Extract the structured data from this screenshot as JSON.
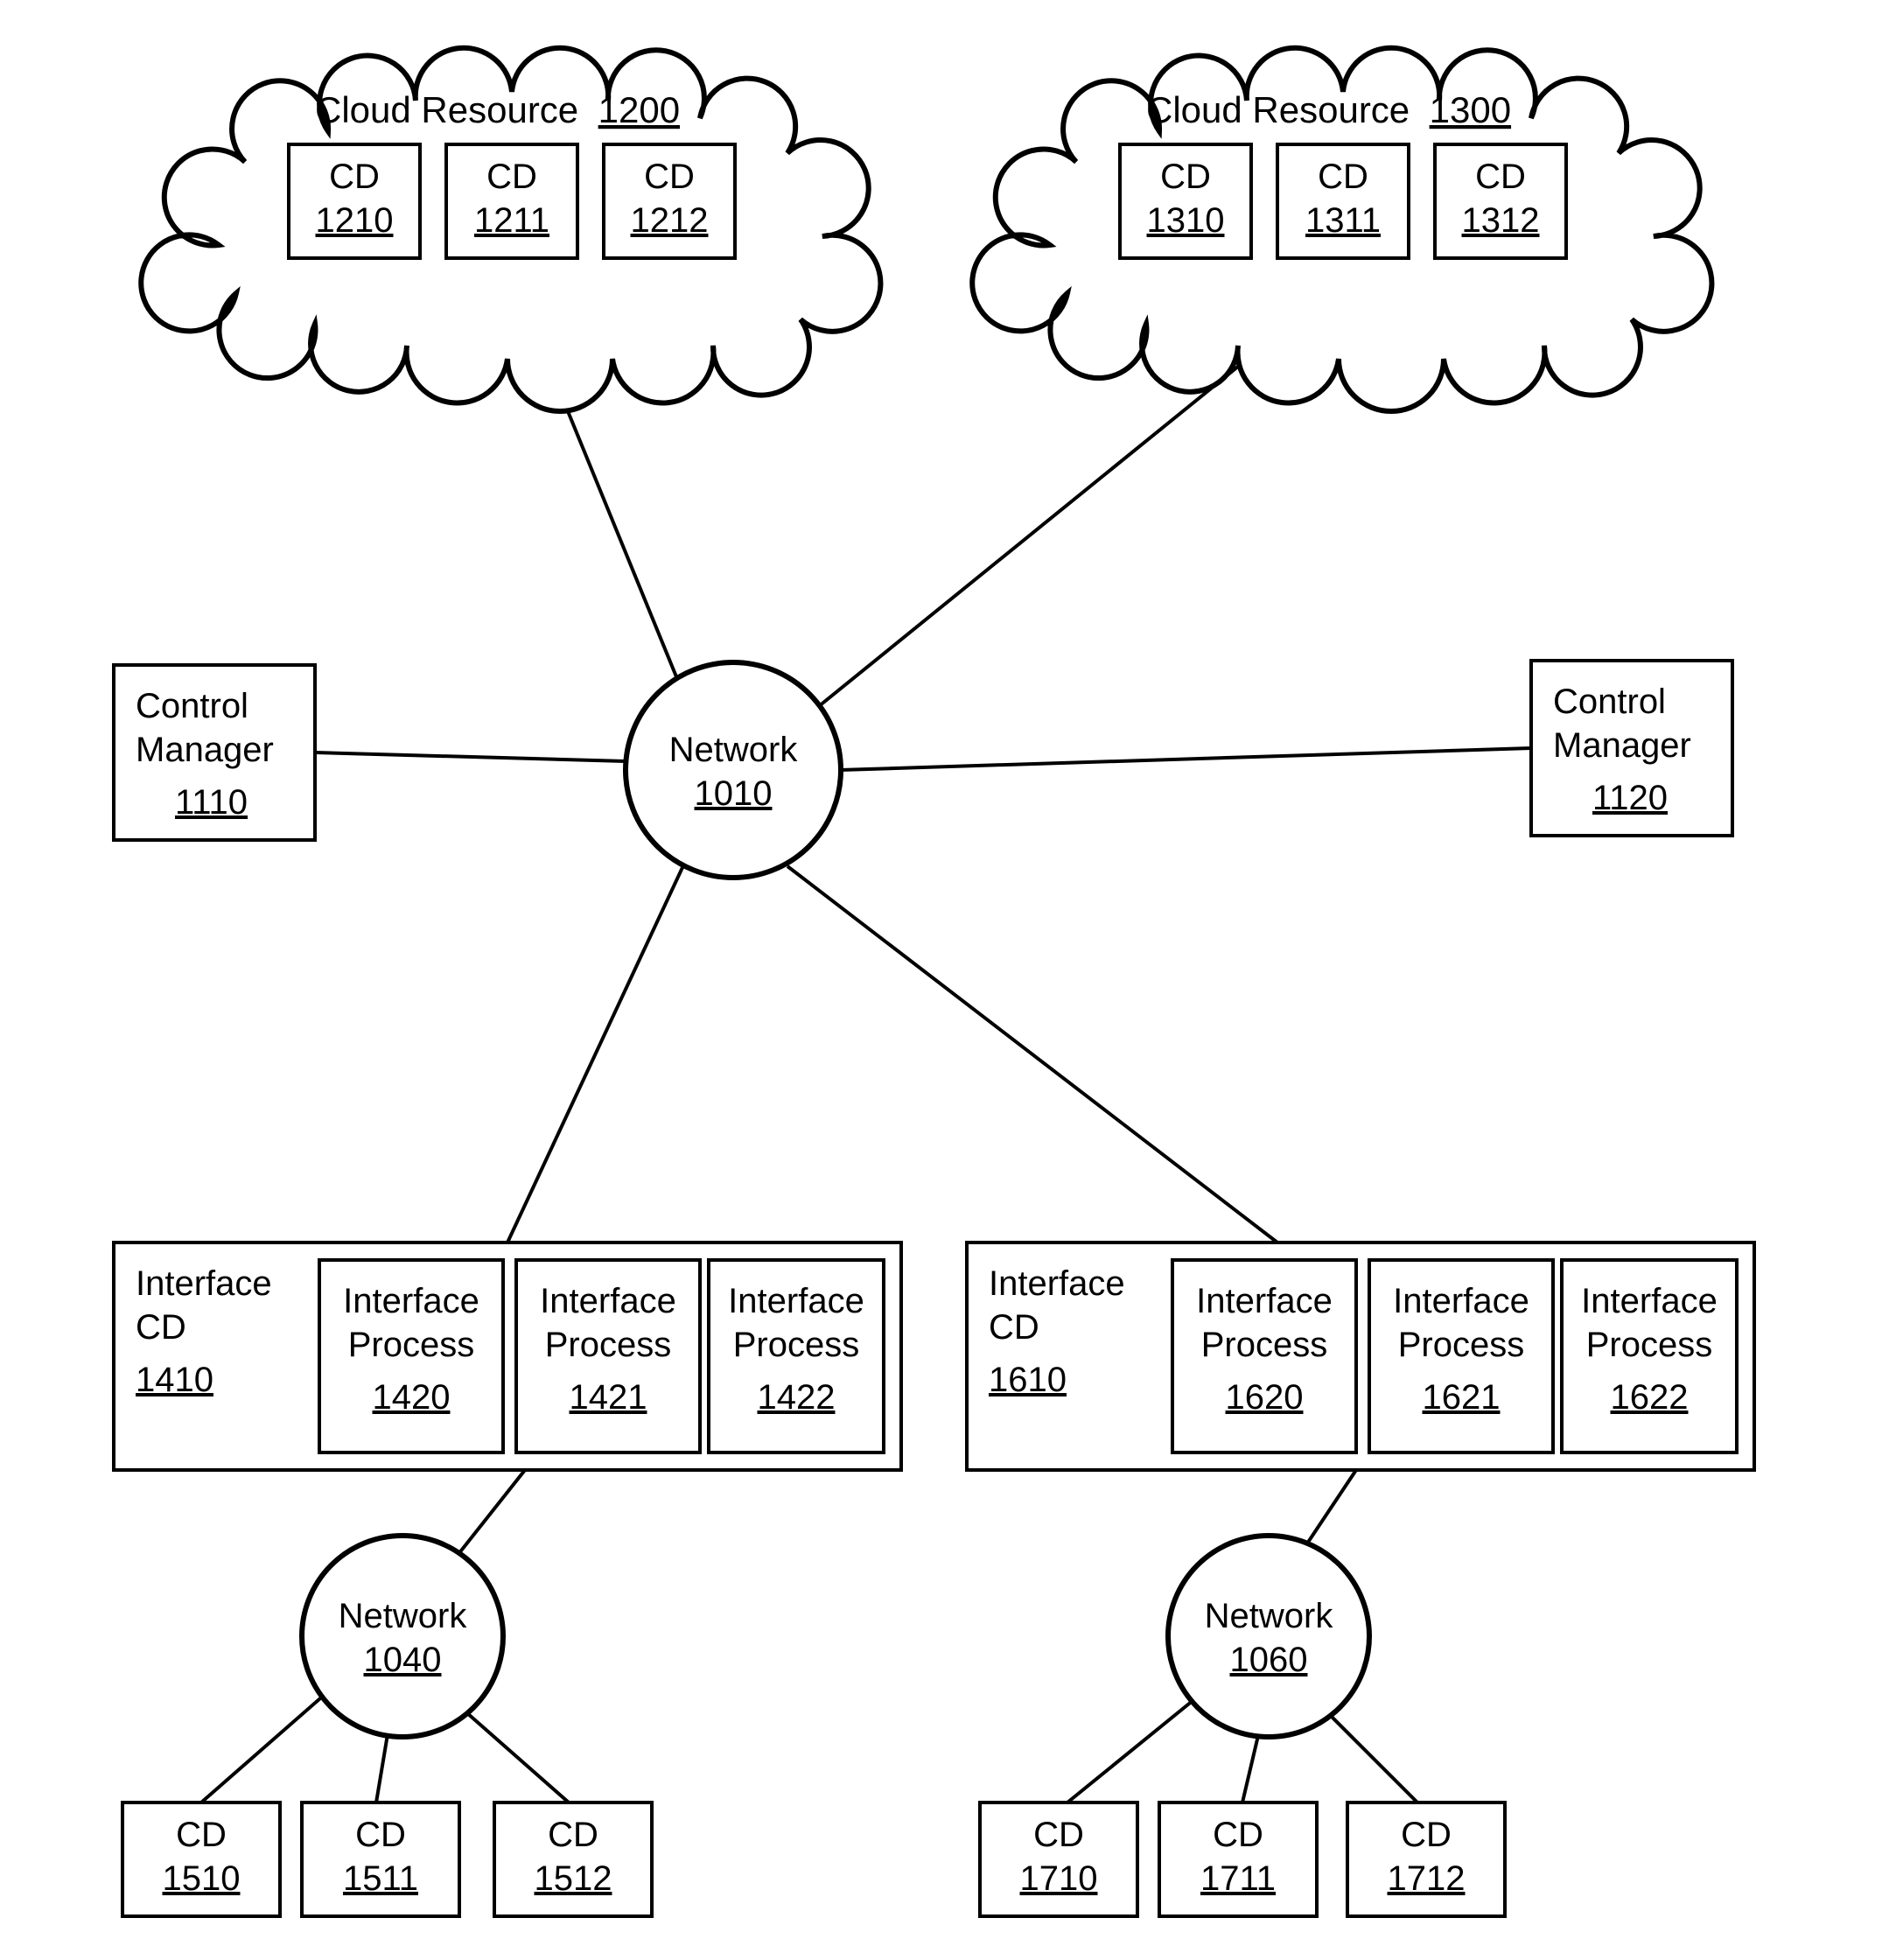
{
  "cloud1": {
    "title_prefix": "Cloud Resource",
    "title_id": "1200",
    "cd1": {
      "label": "CD",
      "id": "1210"
    },
    "cd2": {
      "label": "CD",
      "id": "1211"
    },
    "cd3": {
      "label": "CD",
      "id": "1212"
    }
  },
  "cloud2": {
    "title_prefix": "Cloud Resource",
    "title_id": "1300",
    "cd1": {
      "label": "CD",
      "id": "1310"
    },
    "cd2": {
      "label": "CD",
      "id": "1311"
    },
    "cd3": {
      "label": "CD",
      "id": "1312"
    }
  },
  "network_main": {
    "label": "Network",
    "id": "1010"
  },
  "cm_left": {
    "line1": "Control",
    "line2": "Manager",
    "id": "1110"
  },
  "cm_right": {
    "line1": "Control",
    "line2": "Manager",
    "id": "1120"
  },
  "iface_left": {
    "cd": {
      "line1": "Interface",
      "line2": "CD",
      "id": "1410"
    },
    "p1": {
      "line1": "Interface",
      "line2": "Process",
      "id": "1420"
    },
    "p2": {
      "line1": "Interface",
      "line2": "Process",
      "id": "1421"
    },
    "p3": {
      "line1": "Interface",
      "line2": "Process",
      "id": "1422"
    }
  },
  "iface_right": {
    "cd": {
      "line1": "Interface",
      "line2": "CD",
      "id": "1610"
    },
    "p1": {
      "line1": "Interface",
      "line2": "Process",
      "id": "1620"
    },
    "p2": {
      "line1": "Interface",
      "line2": "Process",
      "id": "1621"
    },
    "p3": {
      "line1": "Interface",
      "line2": "Process",
      "id": "1622"
    }
  },
  "network_left": {
    "label": "Network",
    "id": "1040"
  },
  "network_right": {
    "label": "Network",
    "id": "1060"
  },
  "cd_bl": {
    "a": {
      "label": "CD",
      "id": "1510"
    },
    "b": {
      "label": "CD",
      "id": "1511"
    },
    "c": {
      "label": "CD",
      "id": "1512"
    }
  },
  "cd_br": {
    "a": {
      "label": "CD",
      "id": "1710"
    },
    "b": {
      "label": "CD",
      "id": "1711"
    },
    "c": {
      "label": "CD",
      "id": "1712"
    }
  }
}
